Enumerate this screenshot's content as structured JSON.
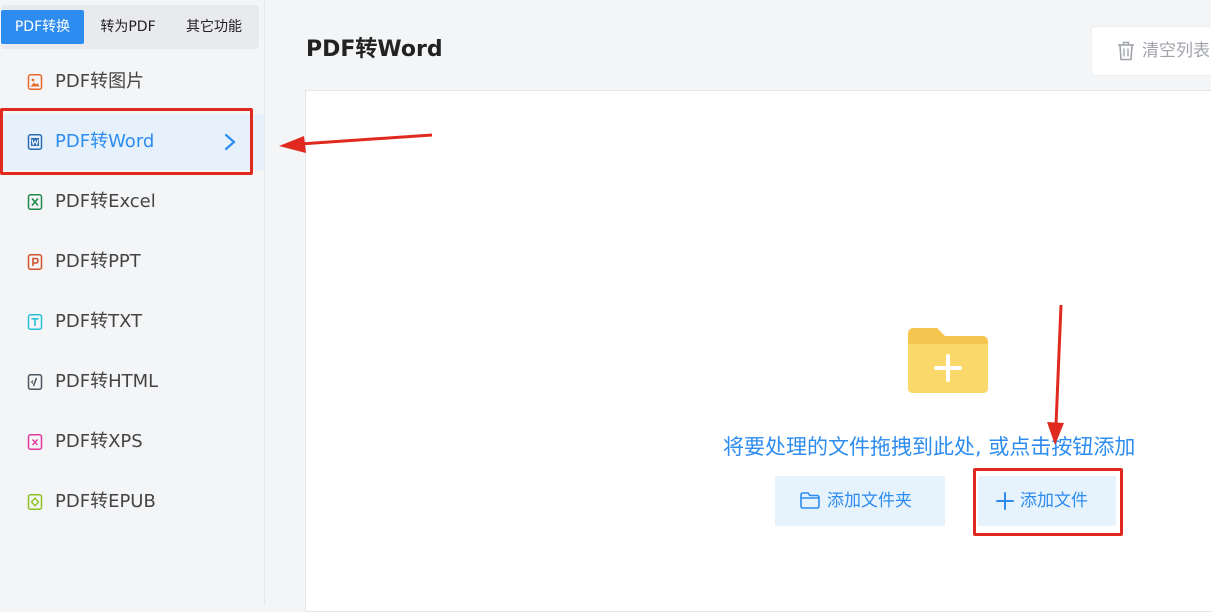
{
  "top_tabs": [
    {
      "label": "PDF转换",
      "active": true
    },
    {
      "label": "转为PDF",
      "active": false
    },
    {
      "label": "其它功能",
      "active": false
    }
  ],
  "menu": [
    {
      "label": "PDF转图片",
      "icon": "image-file-icon",
      "color": "#e8672b"
    },
    {
      "label": "PDF转Word",
      "icon": "word-file-icon",
      "color": "#2d6bb5",
      "active": true
    },
    {
      "label": "PDF转Excel",
      "icon": "excel-file-icon",
      "color": "#21874b"
    },
    {
      "label": "PDF转PPT",
      "icon": "ppt-file-icon",
      "color": "#d2532b"
    },
    {
      "label": "PDF转TXT",
      "icon": "txt-file-icon",
      "color": "#26c1d9"
    },
    {
      "label": "PDF转HTML",
      "icon": "html-file-icon",
      "color": "#4a5560"
    },
    {
      "label": "PDF转XPS",
      "icon": "xps-file-icon",
      "color": "#e0399b"
    },
    {
      "label": "PDF转EPUB",
      "icon": "epub-file-icon",
      "color": "#8dc21f"
    }
  ],
  "main": {
    "title": "PDF转Word",
    "clear_list": "清空列表",
    "hint": "将要处理的文件拖拽到此处, 或点击按钮添加",
    "add_folder": "添加文件夹",
    "add_file": "添加文件"
  },
  "colors": {
    "accent": "#2d8cf0",
    "annotation_red": "#e02a20",
    "folder": "#fbd86a"
  }
}
